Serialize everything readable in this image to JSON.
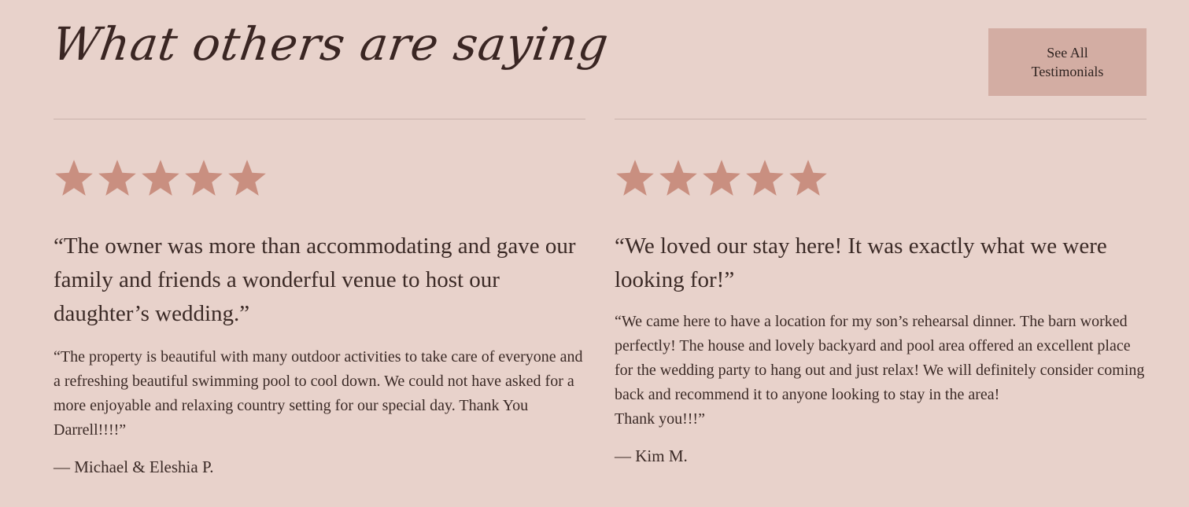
{
  "header": {
    "title": "What others are saying",
    "see_all_label": "See All Testimonials"
  },
  "colors": {
    "background": "#e8d2cb",
    "button_bg": "#d3ada3",
    "star": "#c98f80",
    "text": "#3b2a26",
    "divider": "#c9b2ab"
  },
  "testimonials": [
    {
      "rating": 5,
      "headline": "“The owner was more than accommodating and gave our family and friends a wonderful venue to host our daughter’s wedding.”",
      "body": "“The property is beautiful with many outdoor activities to take care of everyone and a refreshing beautiful swimming pool to cool down. We could not have asked for a more enjoyable and relaxing country setting for our special day. Thank You Darrell!!!!”",
      "author": "— Michael & Eleshia P."
    },
    {
      "rating": 5,
      "headline": "“We loved our stay here! It was exactly what we were looking for!”",
      "body_lines": [
        "“We came here to have a location for my son’s rehearsal dinner. The barn worked perfectly! The house and lovely backyard and pool area offered an excellent place for the wedding party to hang out and just relax! We will definitely consider coming back and recommend it to anyone looking to stay in the area!",
        "Thank you!!!”"
      ],
      "author": "— Kim M."
    }
  ]
}
